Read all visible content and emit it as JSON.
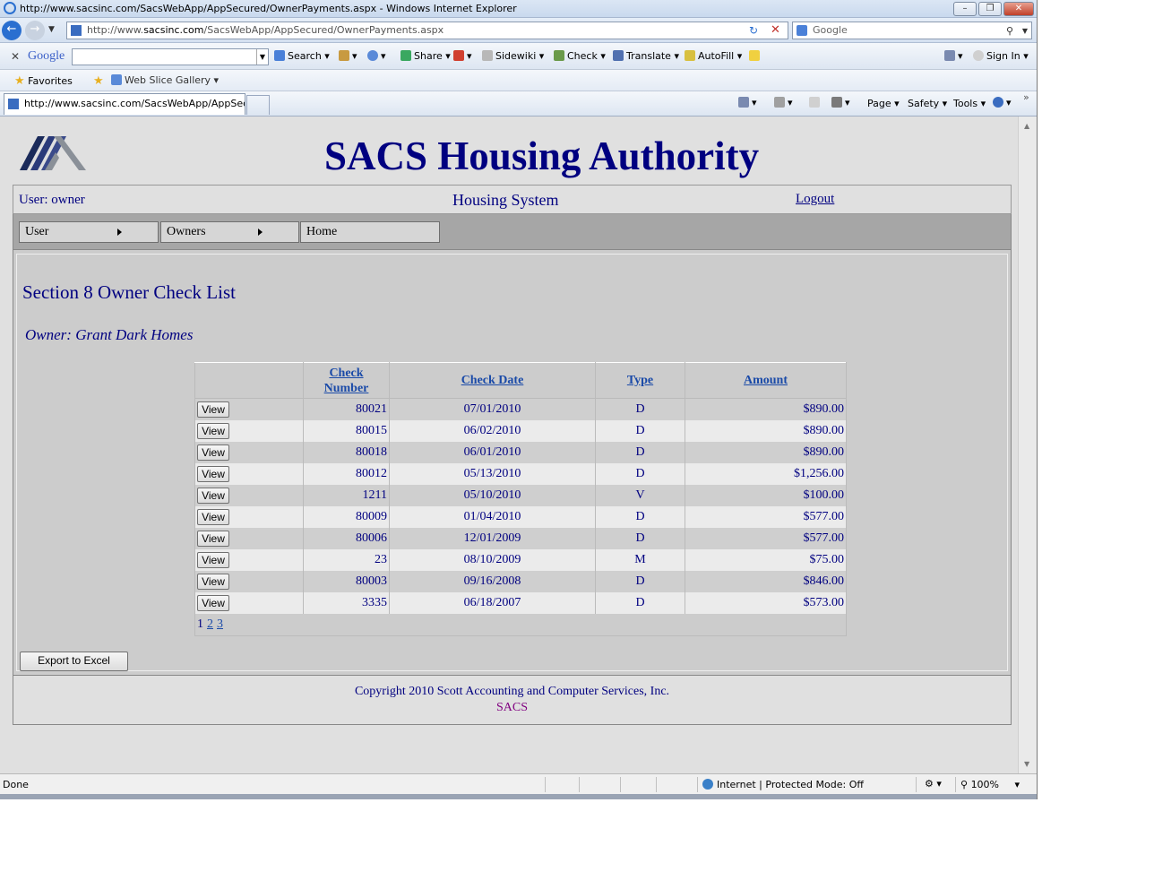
{
  "browser": {
    "title": "http://www.sacsinc.com/SacsWebApp/AppSecured/OwnerPayments.aspx - Windows Internet Explorer",
    "address_prefix": "http://www.",
    "address_domain": "sacsinc.com",
    "address_path": "/SacsWebApp/AppSecured/OwnerPayments.aspx",
    "search_placeholder": "Google",
    "tab_title": "http://www.sacsinc.com/SacsWebApp/AppSecur...",
    "toolbar": {
      "google_logo": "Google",
      "search": "Search",
      "share": "Share",
      "sidewiki": "Sidewiki",
      "check": "Check",
      "translate": "Translate",
      "autofill": "AutoFill",
      "sign_in": "Sign In"
    },
    "favorites": {
      "label": "Favorites",
      "web_slice": "Web Slice Gallery"
    },
    "commands": {
      "page": "Page",
      "safety": "Safety",
      "tools": "Tools"
    },
    "status": {
      "left": "Done",
      "zone": "Internet | Protected Mode: Off",
      "zoom": "100%"
    }
  },
  "site": {
    "title": "SACS Housing Authority",
    "user": "User: owner",
    "system": "Housing System",
    "logout": "Logout",
    "menu": [
      "User",
      "Owners",
      "Home"
    ]
  },
  "page": {
    "title": "Section 8 Owner Check List",
    "owner": "Owner: Grant Dark Homes",
    "columns": {
      "check_number_1": "Check",
      "check_number_2": "Number",
      "check_date": "Check Date",
      "type": "Type",
      "amount": "Amount"
    },
    "view_label": "View",
    "rows": [
      {
        "check": "80021",
        "date": "07/01/2010",
        "type": "D",
        "amount": "$890.00"
      },
      {
        "check": "80015",
        "date": "06/02/2010",
        "type": "D",
        "amount": "$890.00"
      },
      {
        "check": "80018",
        "date": "06/01/2010",
        "type": "D",
        "amount": "$890.00"
      },
      {
        "check": "80012",
        "date": "05/13/2010",
        "type": "D",
        "amount": "$1,256.00"
      },
      {
        "check": "1211",
        "date": "05/10/2010",
        "type": "V",
        "amount": "$100.00"
      },
      {
        "check": "80009",
        "date": "01/04/2010",
        "type": "D",
        "amount": "$577.00"
      },
      {
        "check": "80006",
        "date": "12/01/2009",
        "type": "D",
        "amount": "$577.00"
      },
      {
        "check": "23",
        "date": "08/10/2009",
        "type": "M",
        "amount": "$75.00"
      },
      {
        "check": "80003",
        "date": "09/16/2008",
        "type": "D",
        "amount": "$846.00"
      },
      {
        "check": "3335",
        "date": "06/18/2007",
        "type": "D",
        "amount": "$573.00"
      }
    ],
    "pages": [
      "1",
      "2",
      "3"
    ],
    "export_label": "Export to Excel"
  },
  "footer": {
    "copyright": "Copyright 2010 Scott Accounting and Computer Services, Inc.",
    "sacs": "SACS"
  },
  "colors": {
    "brand_navy": "#000080",
    "link_blue": "#1a4aa8",
    "footer_purple": "#800080"
  }
}
